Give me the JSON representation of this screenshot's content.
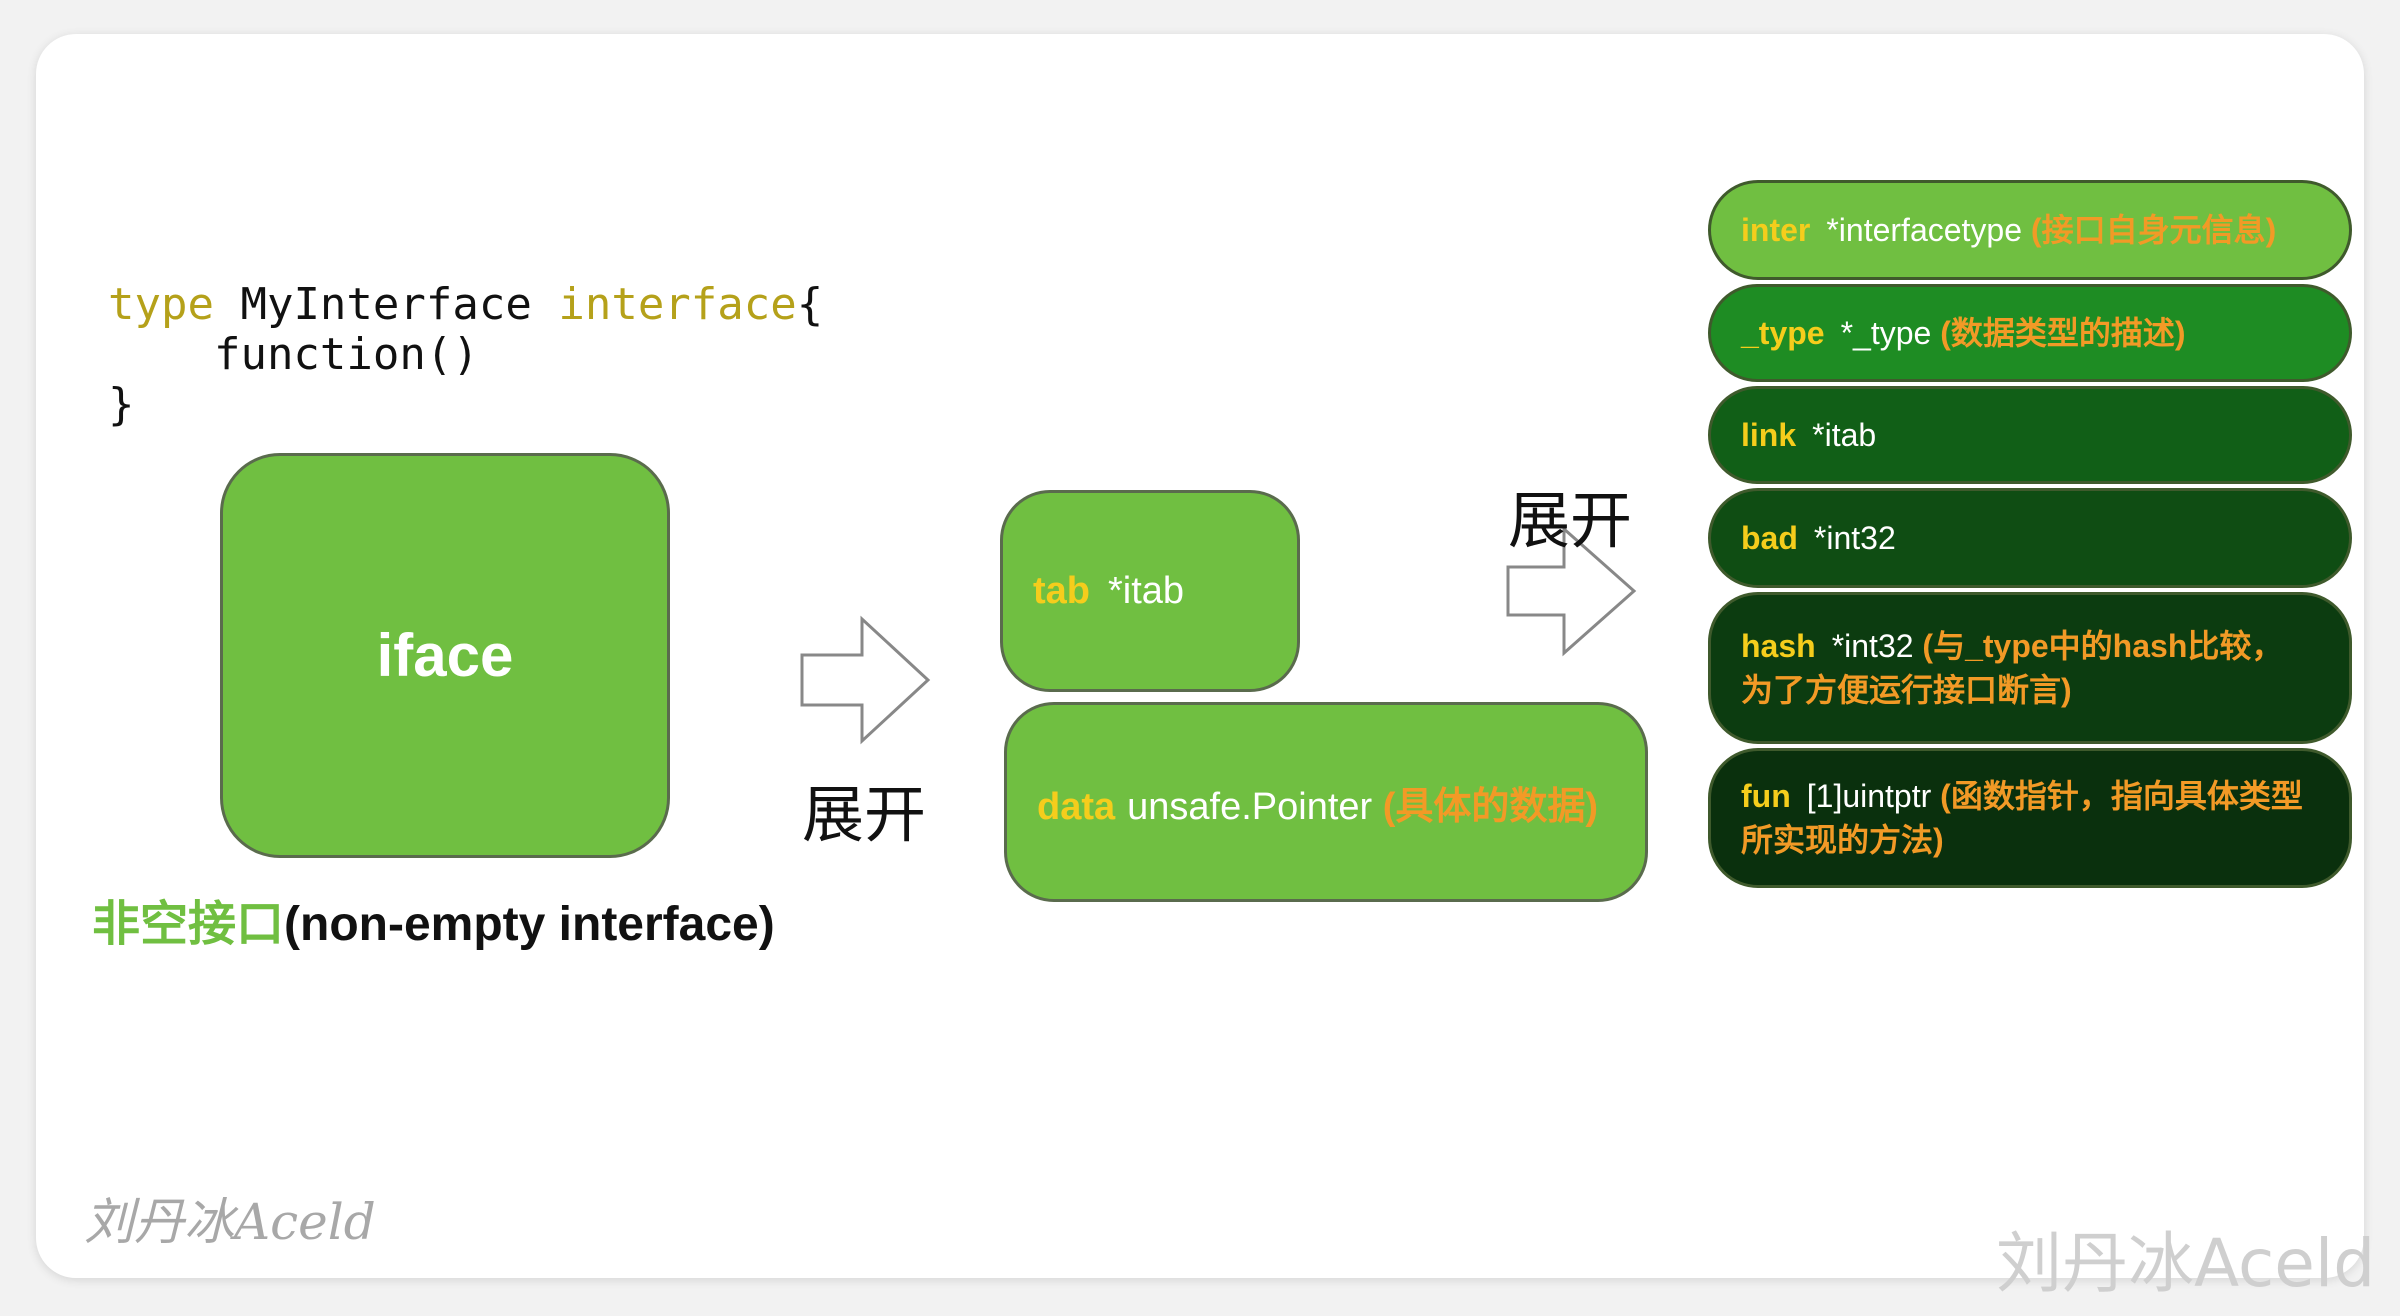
{
  "code": {
    "kw_type": "type",
    "name": " MyInterface ",
    "kw_interface": "interface",
    "brace_open": "{",
    "body": "    function()",
    "brace_close": "}"
  },
  "iface": {
    "label": "iface",
    "caption_cn": "非空接口",
    "caption_en": "(non-empty interface)"
  },
  "expand_label_1": "展开",
  "expand_label_2": "展开",
  "middle": {
    "tab": {
      "name": "tab",
      "type": "*itab"
    },
    "data": {
      "name": "data",
      "type": "unsafe.Pointer",
      "note": "(具体的数据)"
    }
  },
  "itab_fields": [
    {
      "name": "inter",
      "type": "*interfacetype",
      "note": "(接口自身元信息)",
      "color": "#70bf41"
    },
    {
      "name": "_type",
      "type": "*_type",
      "note": "(数据类型的描述)",
      "color": "#1e8c23"
    },
    {
      "name": "link",
      "type": "*itab",
      "note": "",
      "color": "#115f17"
    },
    {
      "name": "bad",
      "type": "*int32",
      "note": "",
      "color": "#0f4d13"
    },
    {
      "name": "hash",
      "type": "*int32",
      "note": "(与_type中的hash比较，为了方便运行接口断言)",
      "color": "#0c3c10"
    },
    {
      "name": "fun",
      "type": "[1]uintptr",
      "note": "(函数指针，指向具体类型所实现的方法)",
      "color": "#0a300d"
    }
  ],
  "watermark_left": "刘丹冰Aceld",
  "watermark_right": "刘丹冰Aceld"
}
